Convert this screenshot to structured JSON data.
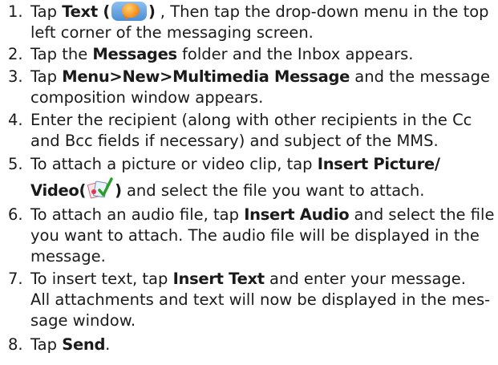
{
  "steps": [
    {
      "num": "1.",
      "l1a": "Tap ",
      "l1b": "Text (",
      "l1c": ")",
      "l1d": " , Then tap the drop-down menu in the top",
      "l2": "left corner of the messaging screen."
    },
    {
      "num": "2.",
      "a": "Tap the ",
      "b": "Messages",
      "c": " folder and the Inbox appears."
    },
    {
      "num": "3.",
      "a": "Tap ",
      "b": "Menu>New>Multimedia Message",
      "c": " and the message",
      "l2": "composition window appears."
    },
    {
      "num": "4.",
      "l1": "Enter the recipient (along with other recipients in the Cc",
      "l2": "and Bcc fields if necessary) and subject of the MMS."
    },
    {
      "num": "5.",
      "a": "To attach a picture or video clip, tap ",
      "b": "Insert Picture/",
      "l2a": "Video(",
      "l2b": ")",
      "l2c": " and select the file you want to attach."
    },
    {
      "num": "6.",
      "a": "To attach an audio file, tap ",
      "b": "Insert Audio",
      "c": " and select the file",
      "l2": "you want to attach. The audio file will be displayed in the",
      "l3": "message."
    },
    {
      "num": "7.",
      "a": "To insert text, tap ",
      "b": "Insert Text",
      "c": " and enter your message.",
      "l2": "All attachments and text will now be displayed in the mes-",
      "l3": "sage window."
    },
    {
      "num": "8.",
      "a": "Tap ",
      "b": "Send",
      "c": "."
    }
  ],
  "icons": {
    "text_app": "text-message-bubble-icon",
    "insert_media": "insert-picture-video-icon"
  },
  "colors": {
    "icon_blue": "#4a8fd6",
    "bubble_orange": "#f5891a"
  }
}
